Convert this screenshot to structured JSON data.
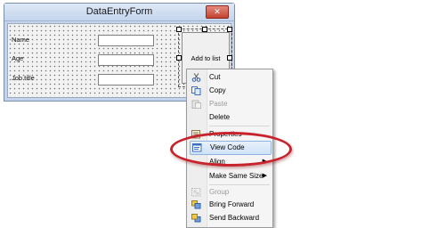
{
  "window": {
    "title": "DataEntryForm",
    "close_glyph": "✕"
  },
  "form": {
    "labels": [
      "Name",
      "Age",
      "Job title"
    ],
    "button_label": "Add to list"
  },
  "context_menu": {
    "items": [
      {
        "label": "Cut",
        "icon": "scissors-icon",
        "enabled": true
      },
      {
        "label": "Copy",
        "icon": "copy-icon",
        "enabled": true
      },
      {
        "label": "Paste",
        "icon": "paste-icon",
        "enabled": false
      },
      {
        "label": "Delete",
        "icon": "",
        "enabled": true
      },
      {
        "label": "Properties",
        "icon": "properties-icon",
        "enabled": true
      },
      {
        "label": "View Code",
        "icon": "view-code-icon",
        "enabled": true,
        "highlighted": true
      },
      {
        "label": "Align",
        "icon": "",
        "enabled": true,
        "submenu": true
      },
      {
        "label": "Make Same Size",
        "icon": "",
        "enabled": true,
        "submenu": true
      },
      {
        "label": "Group",
        "icon": "group-icon",
        "enabled": false
      },
      {
        "label": "Bring Forward",
        "icon": "bring-forward-icon",
        "enabled": true
      },
      {
        "label": "Send Backward",
        "icon": "send-backward-icon",
        "enabled": true
      }
    ],
    "submenu_arrow": "▶"
  },
  "colors": {
    "callout": "#c8222c",
    "highlight": "#cfe3f8"
  }
}
